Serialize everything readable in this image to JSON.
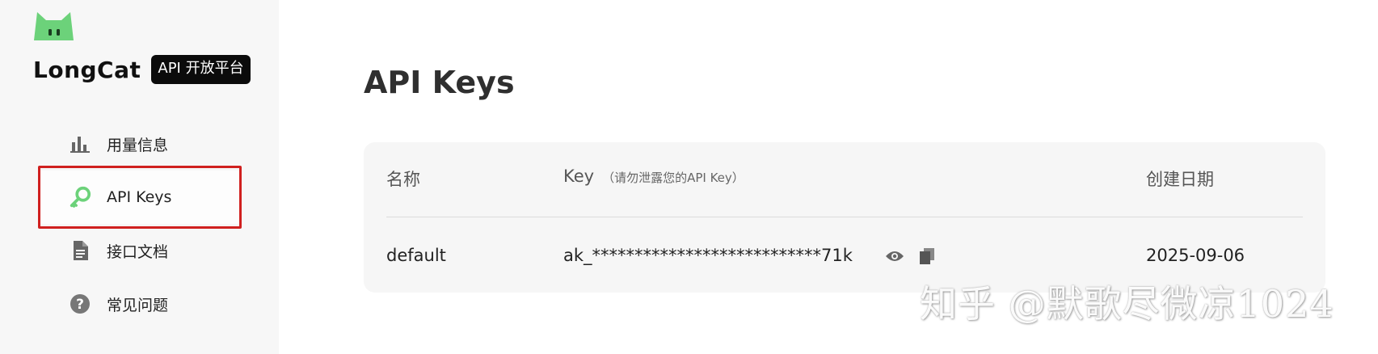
{
  "colors": {
    "brand_green": "#6cd27a",
    "highlight_red": "#d0201f",
    "sidebar_bg": "#f7f7f7",
    "card_bg": "#f6f6f6"
  },
  "brand": {
    "name": "LongCat",
    "badge": "API 开放平台",
    "logo_icon": "cat-logo-icon"
  },
  "sidebar": {
    "items": [
      {
        "label": "用量信息",
        "icon": "bar-chart-icon",
        "active": false
      },
      {
        "label": "API Keys",
        "icon": "key-icon",
        "active": true
      },
      {
        "label": "接口文档",
        "icon": "document-icon",
        "active": false
      },
      {
        "label": "常见问题",
        "icon": "help-circle-icon",
        "active": false
      }
    ]
  },
  "main": {
    "title": "API Keys",
    "table": {
      "headers": {
        "name": "名称",
        "key": "Key",
        "key_hint": "（请勿泄露您的API Key）",
        "created": "创建日期"
      },
      "rows": [
        {
          "name": "default",
          "key": "ak_***************************71k",
          "created": "2025-09-06",
          "actions": [
            "eye-icon",
            "copy-icon"
          ]
        }
      ]
    }
  },
  "watermark": "知乎 @默歌尽微凉1024"
}
